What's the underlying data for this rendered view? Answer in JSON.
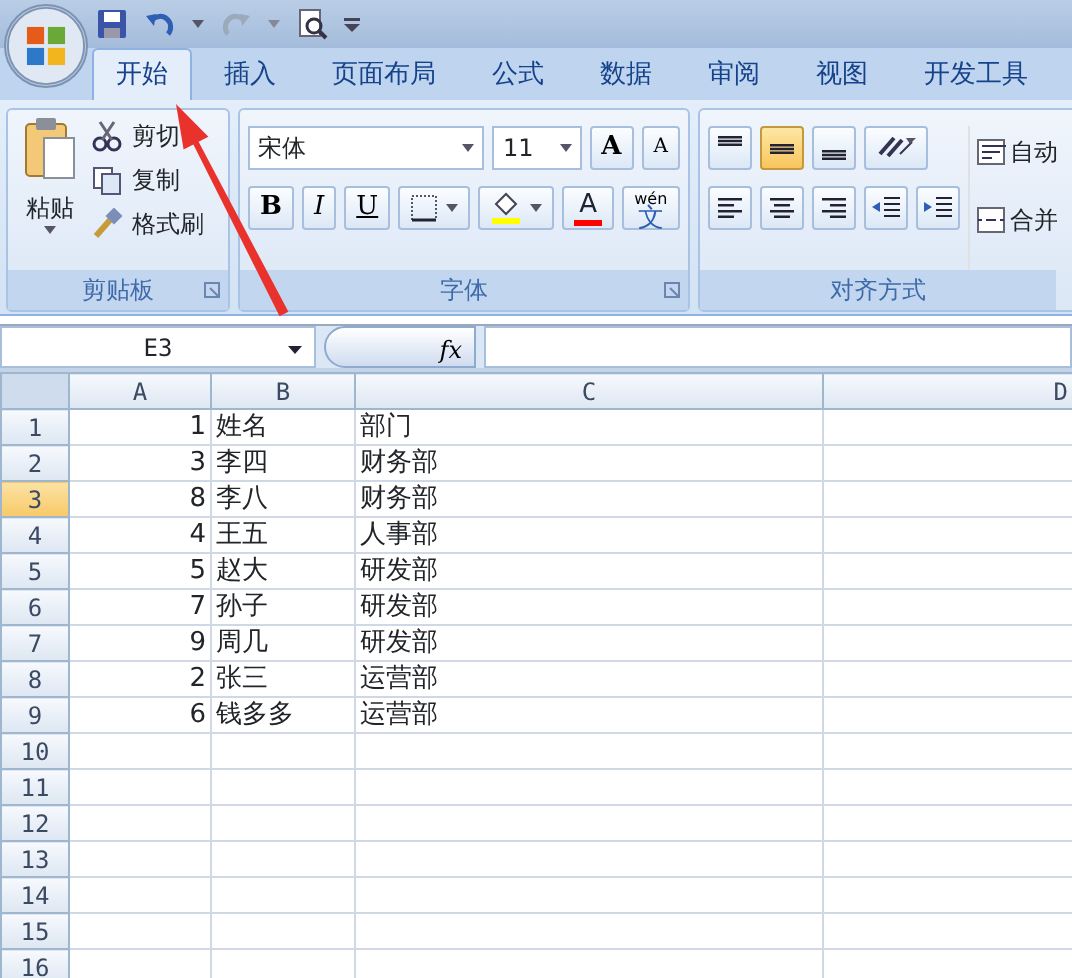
{
  "tabs": [
    {
      "label": "开始",
      "selected": true
    },
    {
      "label": "插入",
      "selected": false
    },
    {
      "label": "页面布局",
      "selected": false
    },
    {
      "label": "公式",
      "selected": false
    },
    {
      "label": "数据",
      "selected": false
    },
    {
      "label": "审阅",
      "selected": false
    },
    {
      "label": "视图",
      "selected": false
    },
    {
      "label": "开发工具",
      "selected": false
    }
  ],
  "ribbon": {
    "clipboard": {
      "paste": "粘贴",
      "items": [
        {
          "kind": "cut",
          "label": "剪切"
        },
        {
          "kind": "copy",
          "label": "复制"
        },
        {
          "kind": "brush",
          "label": "格式刷"
        }
      ],
      "title": "剪贴板"
    },
    "font": {
      "font_name": "宋体",
      "font_size": "11",
      "grow": "A",
      "shrink": "A",
      "styles": [
        "B",
        "I",
        "U"
      ],
      "font_color": "A",
      "phonetic_top": "wén",
      "phonetic": "文",
      "title": "字体"
    },
    "alignment": {
      "vertical": [
        {
          "selected": false
        },
        {
          "selected": true
        },
        {
          "selected": false
        }
      ],
      "wrap": "自动",
      "merge": "合并",
      "title": "对齐方式"
    }
  },
  "formula_bar": {
    "name_box": "E3",
    "function_label": "fx"
  },
  "sheet": {
    "columns": [
      "A",
      "B",
      "C",
      "D"
    ],
    "rows": [
      {
        "header": "1",
        "selected": false,
        "cells": [
          "1",
          "姓名",
          "部门"
        ]
      },
      {
        "header": "2",
        "selected": false,
        "cells": [
          "3",
          "李四",
          "财务部"
        ]
      },
      {
        "header": "3",
        "selected": true,
        "cells": [
          "8",
          "李八",
          "财务部"
        ]
      },
      {
        "header": "4",
        "selected": false,
        "cells": [
          "4",
          "王五",
          "人事部"
        ]
      },
      {
        "header": "5",
        "selected": false,
        "cells": [
          "5",
          "赵大",
          "研发部"
        ]
      },
      {
        "header": "6",
        "selected": false,
        "cells": [
          "7",
          "孙子",
          "研发部"
        ]
      },
      {
        "header": "7",
        "selected": false,
        "cells": [
          "9",
          "周几",
          "研发部"
        ]
      },
      {
        "header": "8",
        "selected": false,
        "cells": [
          "2",
          "张三",
          "运营部"
        ]
      },
      {
        "header": "9",
        "selected": false,
        "cells": [
          "6",
          "钱多多",
          "运营部"
        ]
      },
      {
        "header": "10",
        "selected": false,
        "cells": []
      },
      {
        "header": "11",
        "selected": false,
        "cells": []
      },
      {
        "header": "12",
        "selected": false,
        "cells": []
      },
      {
        "header": "13",
        "selected": false,
        "cells": []
      },
      {
        "header": "14",
        "selected": false,
        "cells": []
      },
      {
        "header": "15",
        "selected": false,
        "cells": []
      },
      {
        "header": "16",
        "selected": false,
        "cells": []
      }
    ]
  }
}
